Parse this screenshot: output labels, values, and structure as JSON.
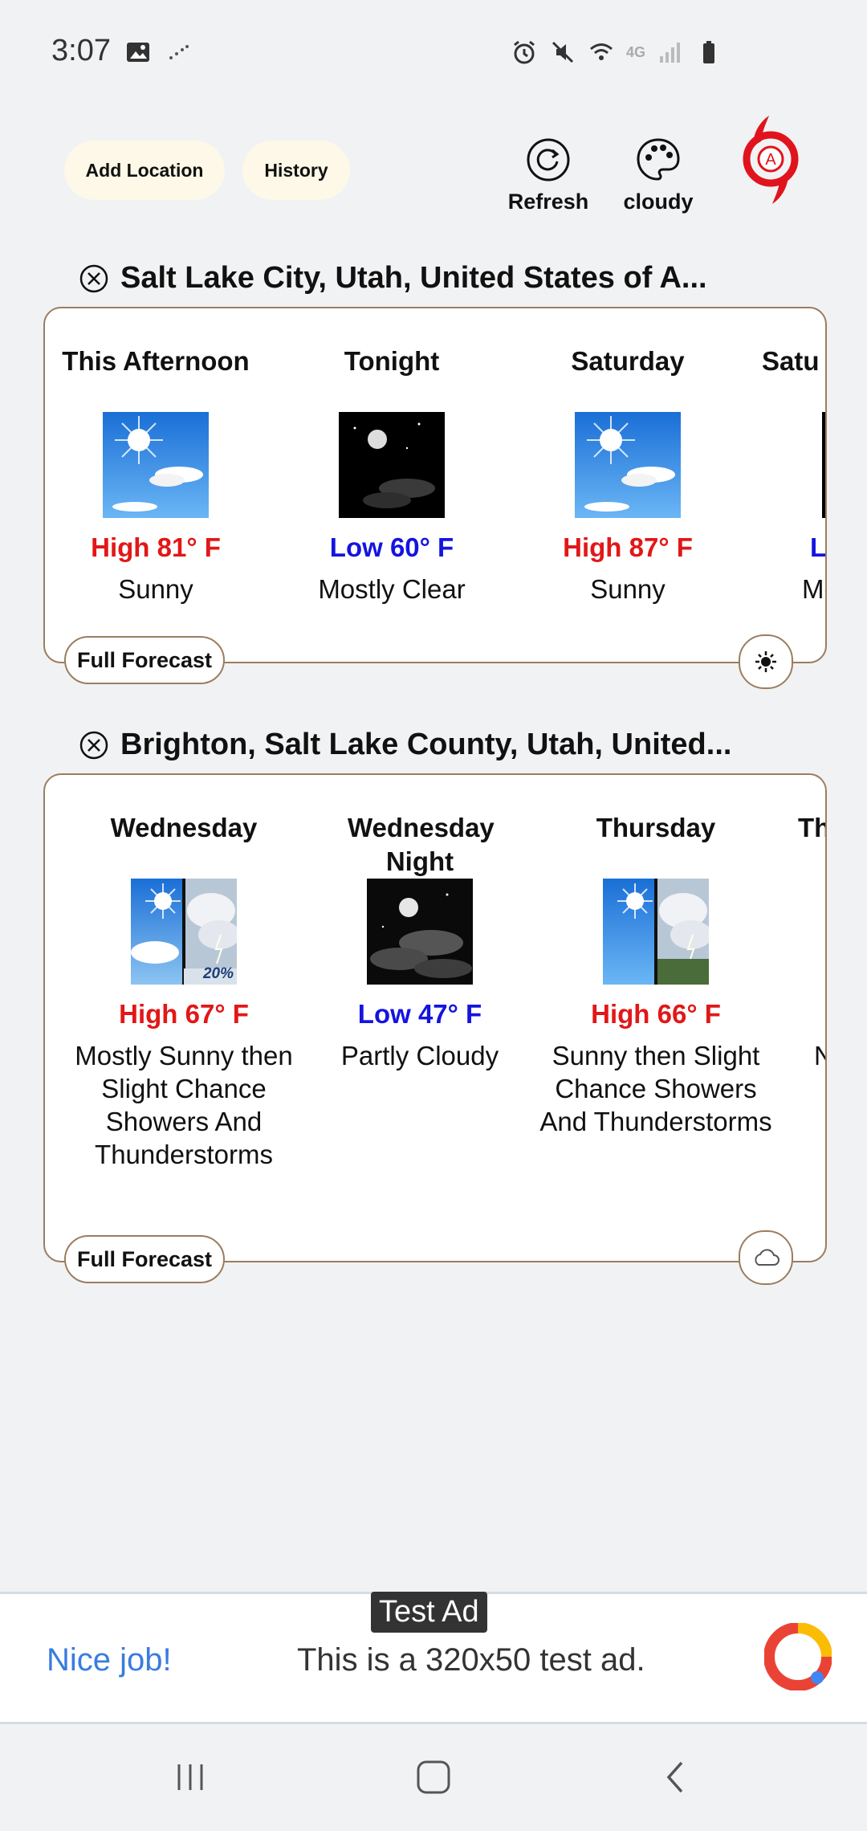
{
  "status_bar": {
    "time": "3:07",
    "left_icons": [
      "image-icon",
      "signal-tracker-icon"
    ],
    "right_icons": [
      "alarm-icon",
      "mute-icon",
      "wifi-icon",
      "4g-icon",
      "signal-icon",
      "battery-icon"
    ],
    "network_label": "4G"
  },
  "toolbar": {
    "add_location_label": "Add Location",
    "history_label": "History",
    "refresh_label": "Refresh",
    "theme_label": "cloudy",
    "logo_icon": "hurricane-logo-icon",
    "logo_letter": "A"
  },
  "locations": [
    {
      "title": "Salt Lake City, Utah, United States of A...",
      "periods": [
        {
          "name": "This Afternoon",
          "image": "sunny",
          "temp": "High 81° F",
          "temp_type": "high",
          "desc": "Sunny"
        },
        {
          "name": "Tonight",
          "image": "clear-night",
          "temp": "Low 60° F",
          "temp_type": "low",
          "desc": "Mostly Clear"
        },
        {
          "name": "Saturday",
          "image": "sunny",
          "temp": "High 87° F",
          "temp_type": "high",
          "desc": "Sunny"
        },
        {
          "name": "Satu",
          "image": "night",
          "temp": "Lo",
          "temp_type": "low",
          "desc": "Mo"
        }
      ],
      "full_forecast_label": "Full Forecast",
      "condition_icon": "sun-icon"
    },
    {
      "title": "Brighton, Salt Lake County, Utah, United...",
      "periods": [
        {
          "name": "Wednesday",
          "image": "sunny-then-storm",
          "image_badge": "20%",
          "temp": "High 67° F",
          "temp_type": "high",
          "desc": "Mostly Sunny then Slight Chance Showers And Thunderstorms"
        },
        {
          "name": "Wednesday Night",
          "image": "partly-cloudy-night",
          "temp": "Low 47° F",
          "temp_type": "low",
          "desc": "Partly Cloudy"
        },
        {
          "name": "Thursday",
          "image": "sunny-then-storm",
          "temp": "High 66° F",
          "temp_type": "high",
          "desc": "Sunny then Slight Chance Showers And Thunderstorms"
        },
        {
          "name": "Th",
          "image": "",
          "temp": "",
          "temp_type": "high",
          "desc": "N"
        }
      ],
      "full_forecast_label": "Full Forecast",
      "condition_icon": "cloud-icon"
    }
  ],
  "ad": {
    "label": "Test Ad",
    "headline": "Nice job!",
    "body": "This is a 320x50 test ad.",
    "logo_icon": "ad-logo-icon"
  },
  "nav": {
    "icons": [
      "recent-apps-icon",
      "home-icon",
      "back-icon"
    ]
  },
  "colors": {
    "high": "#e21717",
    "low": "#1414e0",
    "card_border": "#9b7d5f",
    "pill_bg": "#fdf8e8",
    "ad_blue": "#3a7cde"
  }
}
